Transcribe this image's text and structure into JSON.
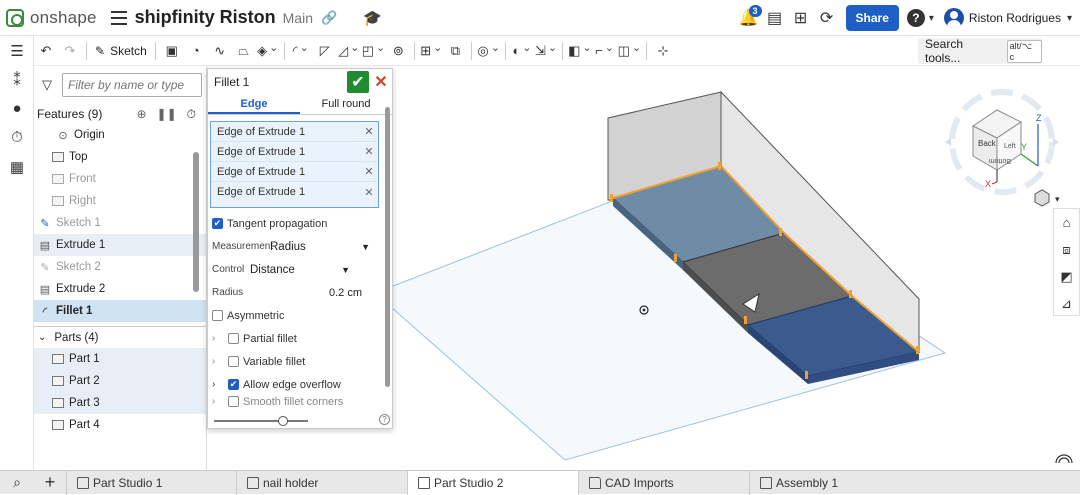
{
  "header": {
    "brand": "onshape",
    "document_title": "shipfinity Riston",
    "branch": "Main",
    "notification_count": "3",
    "share_label": "Share",
    "help_label": "?",
    "user_name": "Riston Rodrigues",
    "accent_color": "#1d5fc4"
  },
  "toolbar": {
    "sketch_label": "Sketch",
    "search_label": "Search tools...",
    "search_shortcut": "alt/⌥ c"
  },
  "feature_panel": {
    "filter_placeholder": "Filter by name or type",
    "features_title": "Features (9)",
    "items": [
      {
        "label": "Origin"
      },
      {
        "label": "Top"
      },
      {
        "label": "Front"
      },
      {
        "label": "Right"
      },
      {
        "label": "Sketch 1"
      },
      {
        "label": "Extrude 1"
      },
      {
        "label": "Sketch 2"
      },
      {
        "label": "Extrude 2"
      },
      {
        "label": "Fillet 1"
      }
    ],
    "parts_title": "Parts (4)",
    "parts": [
      {
        "label": "Part 1"
      },
      {
        "label": "Part 2"
      },
      {
        "label": "Part 3"
      },
      {
        "label": "Part 4"
      }
    ]
  },
  "dialog": {
    "title": "Fillet 1",
    "tab_edge": "Edge",
    "tab_full_round": "Full round",
    "edges": [
      "Edge of Extrude 1",
      "Edge of Extrude 1",
      "Edge of Extrude 1",
      "Edge of Extrude 1"
    ],
    "tangent_propagation": "Tangent propagation",
    "measurement_label": "Measurement",
    "measurement_value": "Radius",
    "control_label": "Control",
    "control_value": "Distance",
    "radius_label": "Radius",
    "radius_value": "0.2 cm",
    "asymmetric": "Asymmetric",
    "partial_fillet": "Partial fillet",
    "variable_fillet": "Variable fillet",
    "allow_edge_overflow": "Allow edge overflow",
    "smooth_fillet_corners": "Smooth fillet corners"
  },
  "view_cube": {
    "face_back": "Back",
    "face_bottom": "Bottom",
    "face_left": "Left",
    "axis_x": "X",
    "axis_y": "Y",
    "axis_z": "Z"
  },
  "tabs": [
    {
      "label": "Part Studio 1"
    },
    {
      "label": "nail holder"
    },
    {
      "label": "Part Studio 2"
    },
    {
      "label": "CAD Imports"
    },
    {
      "label": "Assembly 1"
    }
  ]
}
